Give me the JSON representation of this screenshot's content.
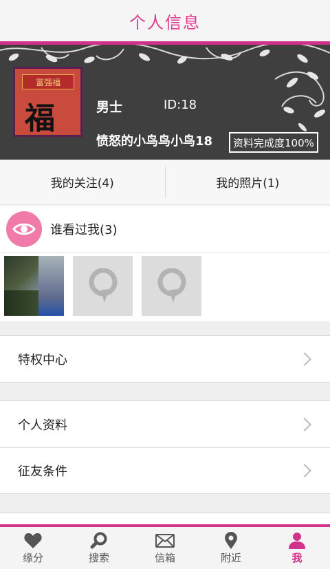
{
  "header": {
    "title": "个人信息"
  },
  "profile": {
    "gender": "男士",
    "id_label": "ID:18",
    "nickname": "愤怒的小鸟鸟小鸟18",
    "completeness": "资料完成度100%",
    "avatar_banner_text": "富强福",
    "avatar_char": "福"
  },
  "tabs": [
    {
      "label": "我的关注(4)"
    },
    {
      "label": "我的照片(1)"
    }
  ],
  "viewers": {
    "label": "谁看过我(3)"
  },
  "menu": {
    "group1": [
      {
        "label": "特权中心"
      }
    ],
    "group2": [
      {
        "label": "个人资料"
      },
      {
        "label": "征友条件"
      }
    ]
  },
  "bottom_nav": [
    {
      "label": "缘分",
      "icon": "heart-icon"
    },
    {
      "label": "搜索",
      "icon": "search-icon"
    },
    {
      "label": "信箱",
      "icon": "mail-icon"
    },
    {
      "label": "附近",
      "icon": "location-pin-icon"
    },
    {
      "label": "我",
      "icon": "person-icon"
    }
  ],
  "colors": {
    "accent": "#d1338a",
    "title": "#e03a8e",
    "banner_bg": "#3f3f3f",
    "eye_badge": "#f07aa8"
  }
}
